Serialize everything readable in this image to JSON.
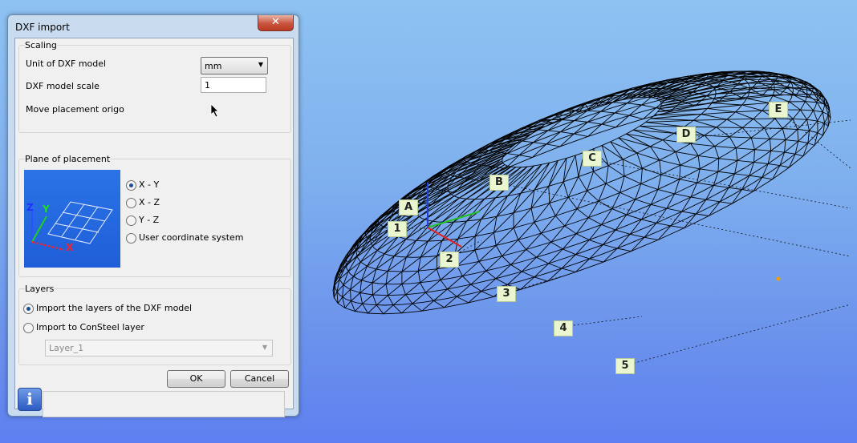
{
  "dialog": {
    "title": "DXF import",
    "close_label": "✕",
    "scaling": {
      "group_title": "Scaling",
      "unit_label": "Unit of DXF model",
      "unit_value": "mm",
      "scale_label": "DXF model scale",
      "scale_value": "1",
      "move_origo_label": "Move placement origo"
    },
    "plane": {
      "group_title": "Plane of placement",
      "axis_x": "X",
      "axis_y": "Y",
      "axis_z": "Z",
      "options": [
        {
          "label": "X - Y",
          "selected": true
        },
        {
          "label": "X - Z",
          "selected": false
        },
        {
          "label": "Y - Z",
          "selected": false
        },
        {
          "label": "User coordinate system",
          "selected": false
        }
      ]
    },
    "layers": {
      "group_title": "Layers",
      "options": [
        {
          "label": "Import the layers of the DXF model",
          "selected": true
        },
        {
          "label": "Import to ConSteel layer",
          "selected": false
        }
      ],
      "layer_value": "Layer_1"
    },
    "ok_label": "OK",
    "cancel_label": "Cancel",
    "info_icon": "i"
  },
  "viewport": {
    "letter_labels": [
      "A",
      "B",
      "C",
      "D",
      "E"
    ],
    "number_labels": [
      "1",
      "2",
      "3",
      "4",
      "5"
    ],
    "colors": {
      "background_top": "#8ec2f2",
      "background_bottom": "#5e7ff0",
      "mesh": "#000000",
      "axis_x": "#e02020",
      "axis_y": "#22c022",
      "axis_z": "#2040e0",
      "label_bg": "#e9f6cf"
    }
  }
}
